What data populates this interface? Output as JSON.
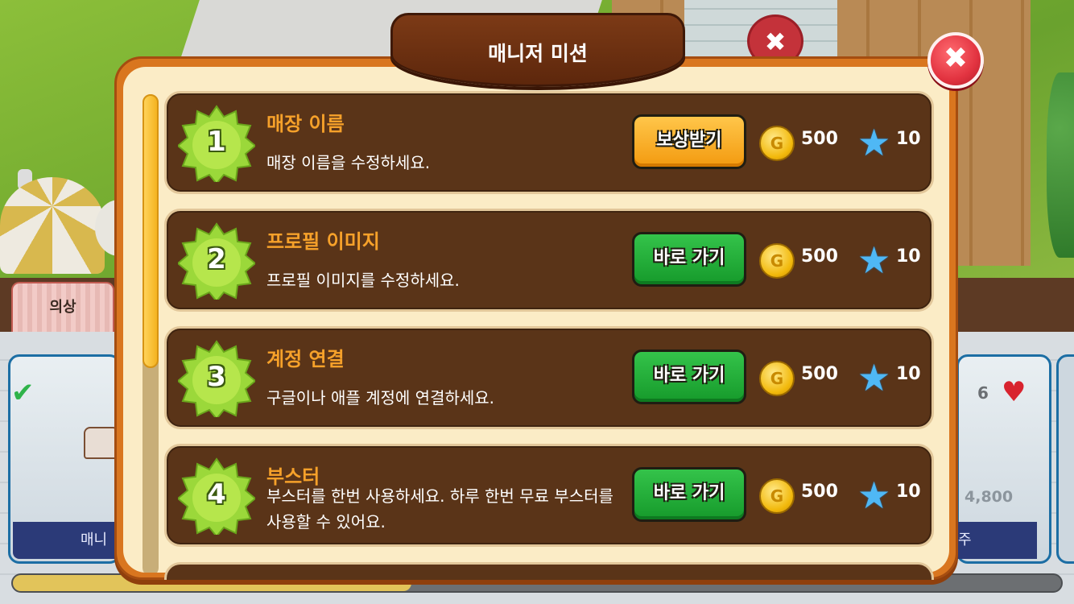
{
  "dialog": {
    "title": "매니저 미션",
    "close_icon": "close-x-icon"
  },
  "missions": [
    {
      "number": "1",
      "title": "매장 이름",
      "description": "매장 이름을 수정하세요.",
      "button_label": "보상받기",
      "button_style": "reward",
      "coin_reward": "500",
      "star_reward": "10"
    },
    {
      "number": "2",
      "title": "프로필 이미지",
      "description": "프로필 이미지를 수정하세요.",
      "button_label": "바로 가기",
      "button_style": "go",
      "coin_reward": "500",
      "star_reward": "10"
    },
    {
      "number": "3",
      "title": "계정 연결",
      "description": "구글이나 애플 계정에 연결하세요.",
      "button_label": "바로 가기",
      "button_style": "go",
      "coin_reward": "500",
      "star_reward": "10"
    },
    {
      "number": "4",
      "title": "부스터",
      "description": "부스터를 한번 사용하세요. 하루 한번 무료 부스터를 사용할 수 있어요.",
      "button_label": "바로 가기",
      "button_style": "go",
      "coin_reward": "500",
      "star_reward": "10"
    }
  ],
  "background": {
    "tab_label": "의상",
    "left_card_footer": "매니",
    "right_card_footer": "주",
    "heart_count": "6",
    "price": "4,800",
    "progress_fraction": 0.38
  },
  "colors": {
    "mission_title": "#f6a12a",
    "reward_button": "#f39a0f",
    "go_button": "#169a2b",
    "modal_frame": "#d9761f",
    "modal_fill": "#fbecc6",
    "row_fill": "#5a3418",
    "close_button": "#e23340"
  }
}
